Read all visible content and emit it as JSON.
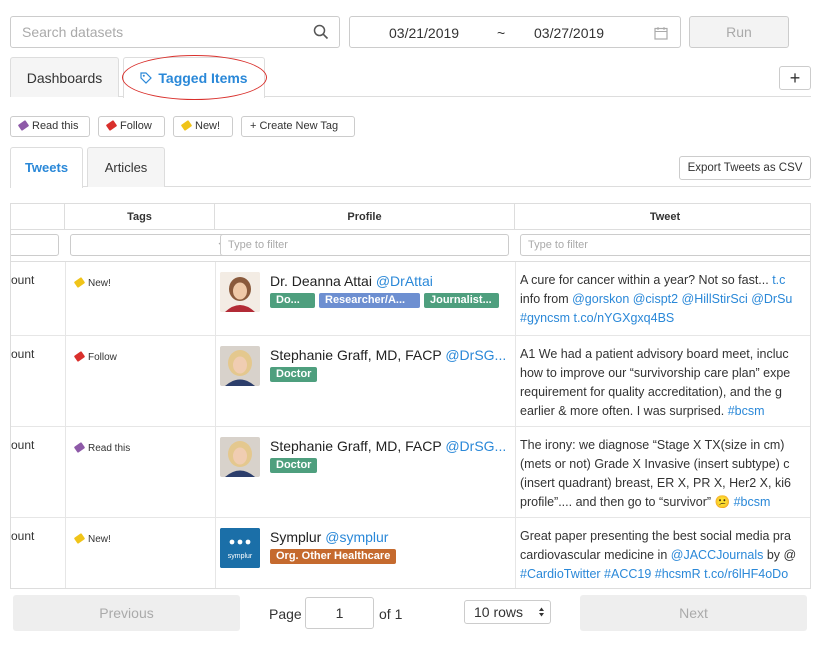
{
  "search": {
    "placeholder": "Search datasets"
  },
  "date_range": {
    "start": "03/21/2019",
    "separator": "~",
    "end": "03/27/2019"
  },
  "run_label": "Run",
  "main_tabs": [
    "Dashboards",
    "Tagged Items"
  ],
  "add_label": "+",
  "tag_pills": [
    {
      "label": "Read this",
      "color": "#8e5aa8"
    },
    {
      "label": "Follow",
      "color": "#d9302c"
    },
    {
      "label": "New!",
      "color": "#f0c419"
    }
  ],
  "create_tag_label": "+ Create New Tag",
  "sub_tabs": [
    "Tweets",
    "Articles"
  ],
  "export_label": "Export Tweets as CSV",
  "table": {
    "headers": [
      "Tags",
      "Profile",
      "Tweet"
    ],
    "filter_placeholder": "Type to filter",
    "rows": [
      {
        "col0": "ount",
        "tag": "New!",
        "tag_color": "#f0c419",
        "name": "Dr. Deanna Attai",
        "handle": "@DrAttai",
        "badges": [
          {
            "label": "Do...",
            "color": "#4e9f7e"
          },
          {
            "label": "Researcher/A...",
            "color": "#6d8fd1"
          },
          {
            "label": "Journalist...",
            "color": "#4e9f7e"
          }
        ],
        "tweet": [
          "A cure for cancer within a year? Not so fast... ",
          "t.c",
          "info from ",
          "@gorskon @cispt2 @HillStirSci @DrSu",
          "#gyncsm t.co/nYGXgxq4BS"
        ]
      },
      {
        "col0": "ount",
        "tag": "Follow",
        "tag_color": "#d9302c",
        "name": "Stephanie Graff, MD, FACP",
        "handle": "@DrSG...",
        "badges": [
          {
            "label": "Doctor",
            "color": "#4e9f7e"
          }
        ],
        "tweet": [
          "A1 We had a patient advisory board meet, incluc",
          "how to improve our “survivorship care plan” expe",
          "requirement for quality accreditation), and the g",
          "earlier & more often. I was surprised. ",
          "#bcsm"
        ]
      },
      {
        "col0": "ount",
        "tag": "Read this",
        "tag_color": "#8e5aa8",
        "name": "Stephanie Graff, MD, FACP",
        "handle": "@DrSG...",
        "badges": [
          {
            "label": "Doctor",
            "color": "#4e9f7e"
          }
        ],
        "tweet": [
          "The irony: we diagnose “Stage X TX(size in cm)",
          "(mets or not) Grade X Invasive (insert subtype) c",
          "(insert quadrant) breast, ER X, PR X, Her2 X, ki6",
          "profile”.... and then go to “survivor” 😕 ",
          "#bcsm"
        ]
      },
      {
        "col0": "ount",
        "tag": "New!",
        "tag_color": "#f0c419",
        "name": "Symplur",
        "handle": "@symplur",
        "logo_text": "symplur",
        "badges": [
          {
            "label": "Org. Other Healthcare",
            "color": "#c56a2e"
          }
        ],
        "tweet": [
          "Great paper presenting the best social media pra",
          "cardiovascular medicine in ",
          "@JACCJournals",
          " by @",
          "#CardioTwitter #ACC19 #hcsmR t.co/r6lHF4oDo"
        ]
      }
    ]
  },
  "pager": {
    "previous": "Previous",
    "page_label": "Page",
    "page": "1",
    "of_label": "of 1",
    "rows": "10 rows",
    "next": "Next"
  },
  "colors": {
    "accent": "#2a88d8",
    "highlight_circle": "#d9302c"
  }
}
